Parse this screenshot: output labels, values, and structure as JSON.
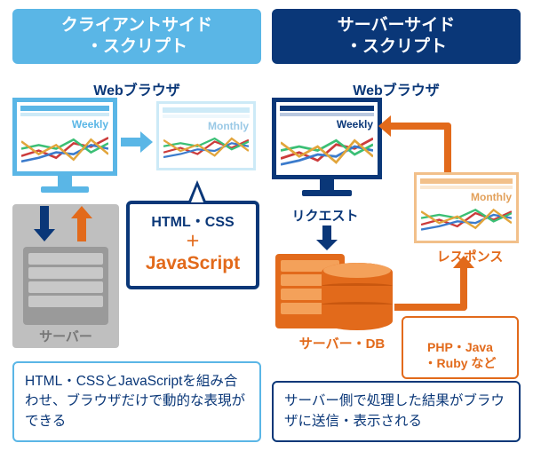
{
  "left": {
    "title": "クライアントサイド\n・スクリプト",
    "browser_label": "Webブラウザ",
    "monitor1_tag": "Weekly",
    "monitor2_tag": "Monthly",
    "callout": {
      "line1": "HTML・CSS",
      "plus": "＋",
      "js": "JavaScript"
    },
    "server_label": "サーバー",
    "caption": "HTML・CSSとJavaScriptを組み合わせ、ブラウザだけで動的な表現ができる"
  },
  "right": {
    "title": "サーバーサイド\n・スクリプト",
    "browser_label": "Webブラウザ",
    "monitor1_tag": "Weekly",
    "monitor2_tag": "Monthly",
    "request_label": "リクエスト",
    "response_label": "レスポンス",
    "server_db_label": "サーバー・DB",
    "langs": "PHP・Java\n・Ruby など",
    "caption": "サーバー側で処理した結果がブラウザに送信・表示される"
  },
  "colors": {
    "lightblue": "#5ab6e6",
    "navy": "#0a3778",
    "orange": "#e26a1b",
    "grey": "#bfbfbf"
  }
}
